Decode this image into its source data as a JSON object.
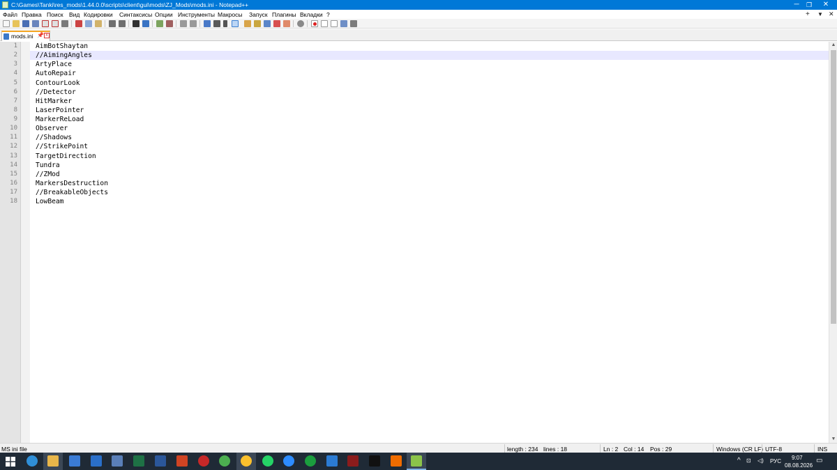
{
  "window": {
    "title": "C:\\Games\\Tanki\\res_mods\\1.44.0.0\\scripts\\client\\gui\\mods\\ZJ_Mods\\mods.ini - Notepad++",
    "minimize": "─",
    "restore": "❐",
    "close": "✕"
  },
  "menubar": {
    "items": [
      "Файл",
      "Правка",
      "Поиск",
      "Вид",
      "Кодировки",
      "Синтаксисы",
      "Опции",
      "Инструменты",
      "Макросы",
      "Запуск",
      "Плагины",
      "Вкладки",
      "?"
    ],
    "right_plus": "+",
    "right_down": "▼",
    "right_close": "✕"
  },
  "tab": {
    "label": "mods.ini",
    "pin": "📌",
    "close": "x"
  },
  "editor": {
    "current_line": 2,
    "lines": [
      {
        "num": "1",
        "text": "AimBotShaytan"
      },
      {
        "num": "2",
        "text": "//AimingAngles"
      },
      {
        "num": "3",
        "text": "ArtyPlace"
      },
      {
        "num": "4",
        "text": "AutoRepair"
      },
      {
        "num": "5",
        "text": "ContourLook"
      },
      {
        "num": "6",
        "text": "//Detector"
      },
      {
        "num": "7",
        "text": "HitMarker"
      },
      {
        "num": "8",
        "text": "LaserPointer"
      },
      {
        "num": "9",
        "text": "MarkerReLoad"
      },
      {
        "num": "10",
        "text": "Observer"
      },
      {
        "num": "11",
        "text": "//Shadows"
      },
      {
        "num": "12",
        "text": "//StrikePoint"
      },
      {
        "num": "13",
        "text": "TargetDirection"
      },
      {
        "num": "14",
        "text": "Tundra"
      },
      {
        "num": "15",
        "text": "//ZMod"
      },
      {
        "num": "16",
        "text": "MarkersDestruction"
      },
      {
        "num": "17",
        "text": "//BreakableObjects"
      },
      {
        "num": "18",
        "text": "LowBeam"
      }
    ]
  },
  "scrollbar": {
    "up": "▲",
    "down": "▼"
  },
  "statusbar": {
    "filetype": "MS ini file",
    "length": "length : 234",
    "lines": "lines : 18",
    "ln": "Ln : 2",
    "col": "Col : 14",
    "pos": "Pos : 29",
    "eol": "Windows (CR LF)",
    "encoding": "UTF-8",
    "mode": "INS"
  },
  "taskbar": {
    "lang": "РУС",
    "time": "9:07",
    "date": "08.08.2026",
    "tray_chevron": "^",
    "colors": {
      "start": "#ffffff",
      "edge": "#2f8fd8",
      "explorer": "#e8b64a",
      "store": "#3a7bd5",
      "outlook": "#2a6fc9",
      "snip": "#5a7fb8",
      "excel": "#1e7145",
      "word": "#2b579a",
      "powerpoint": "#d04423",
      "red_app": "#c62828",
      "chrome1": "#4caf50",
      "chrome2": "#fbc02d",
      "whatsapp": "#25d366",
      "zoom": "#2d8cff",
      "green_app": "#1b9e3e",
      "blue_app": "#2b7bd3",
      "dark_app": "#8b1c1c",
      "terminal": "#111111",
      "orange_app": "#ef6c00",
      "notepadpp": "#8bc34a"
    }
  }
}
